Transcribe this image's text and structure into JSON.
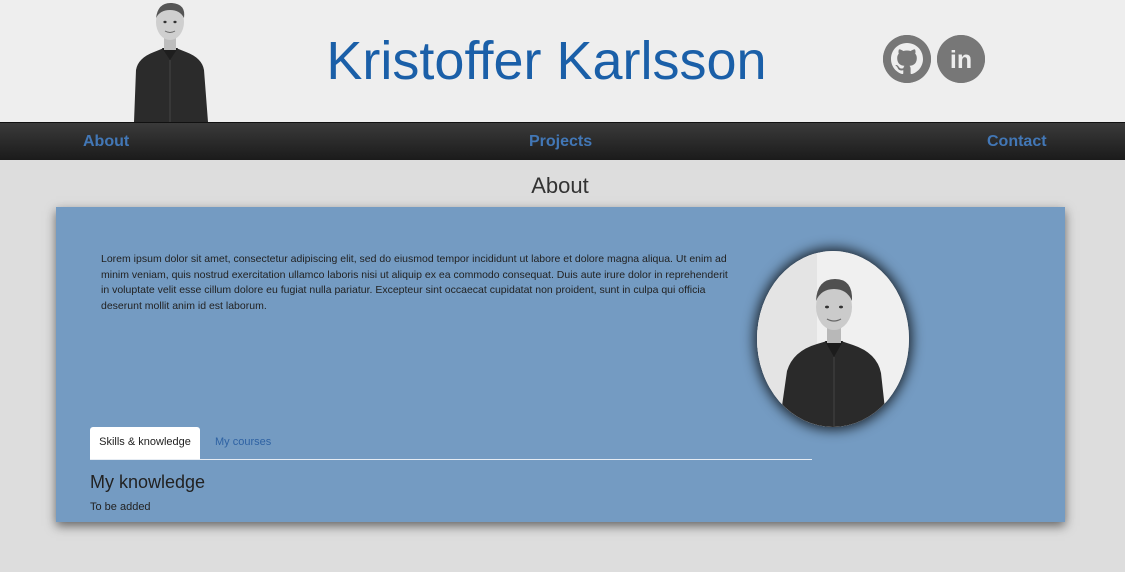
{
  "header": {
    "title": "Kristoffer Karlsson",
    "photo": "portrait-photo",
    "social": [
      {
        "name": "github-icon"
      },
      {
        "name": "linkedin-icon",
        "glyph": "in"
      }
    ]
  },
  "nav": {
    "about": "About",
    "projects": "Projects",
    "contact": "Contact"
  },
  "section": {
    "title": "About"
  },
  "about": {
    "text": "Lorem ipsum dolor sit amet, consectetur adipiscing elit, sed do eiusmod tempor incididunt ut labore et dolore magna aliqua. Ut enim ad minim veniam, quis nostrud exercitation ullamco laboris nisi ut aliquip ex ea commodo consequat. Duis aute irure dolor in reprehenderit in voluptate velit esse cillum dolore eu fugiat nulla pariatur. Excepteur sint occaecat cupidatat non proident, sunt in culpa qui officia deserunt mollit anim id est laborum."
  },
  "tabs": [
    {
      "label": "Skills & knowledge",
      "active": true
    },
    {
      "label": "My courses",
      "active": false
    }
  ],
  "knowledge": {
    "heading": "My knowledge",
    "text": "To be added"
  },
  "colors": {
    "title_blue": "#1a5fa8",
    "nav_link": "#4277b6",
    "card_bg": "#749bc2",
    "icon_gray": "#777777"
  }
}
